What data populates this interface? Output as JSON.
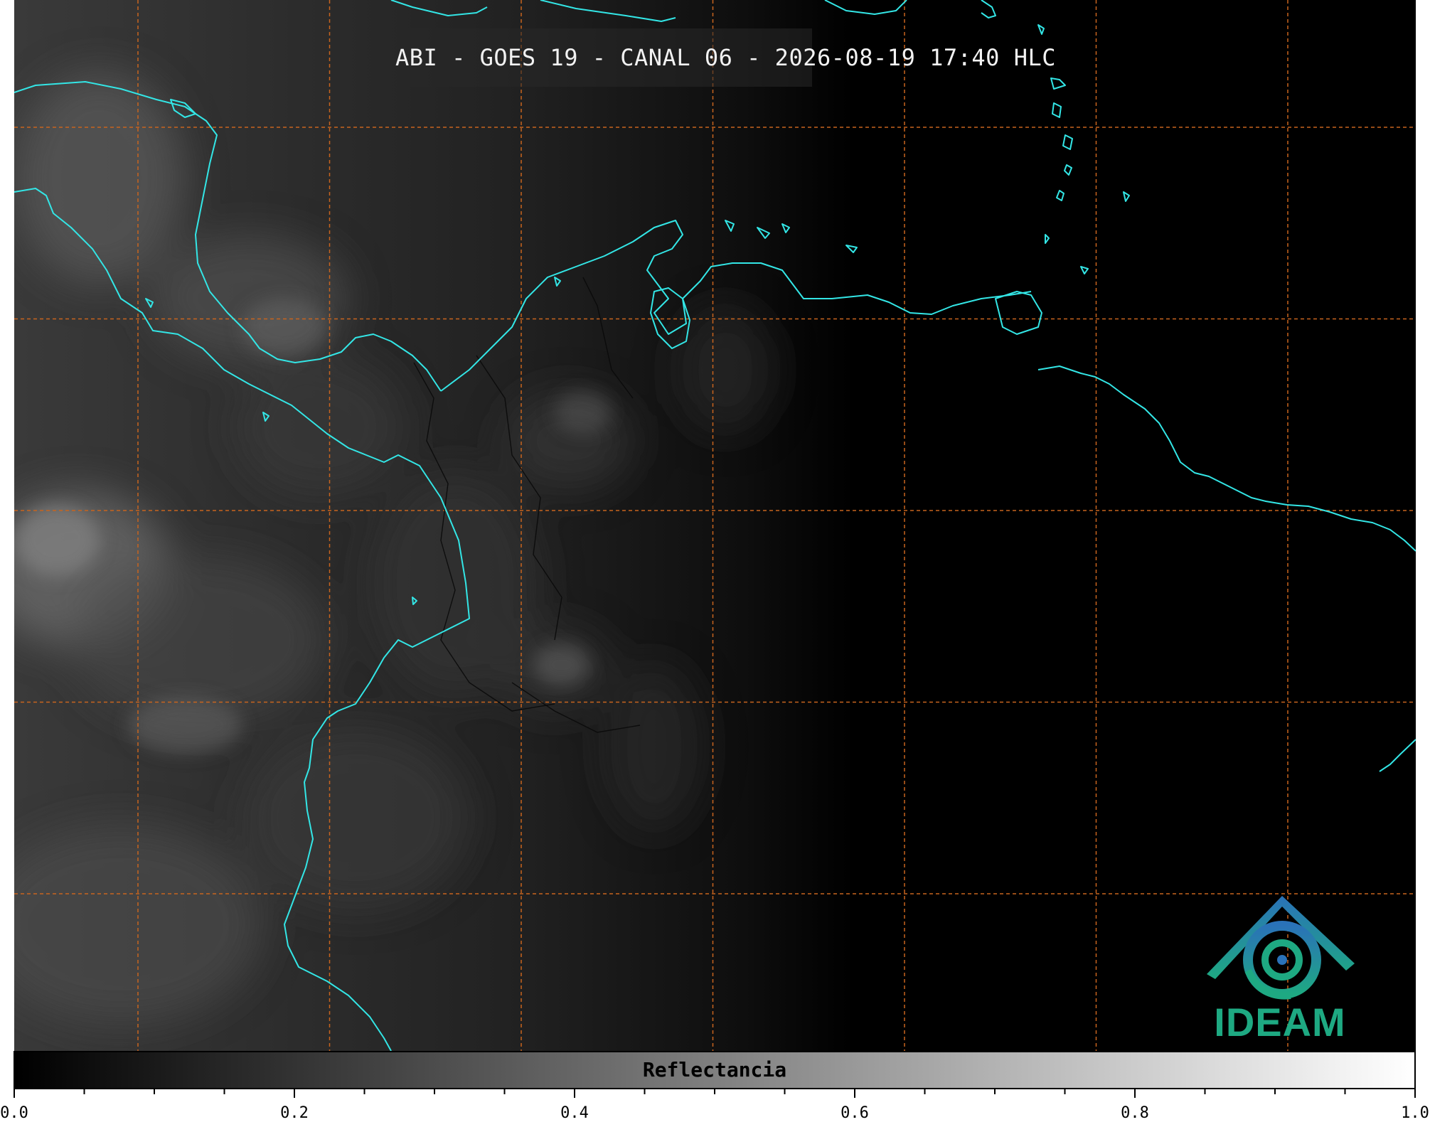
{
  "title": "ABI - GOES 19 - CANAL 06 - 2026-08-19 17:40 HLC",
  "colors": {
    "coastline": "#33e6e6",
    "gridline": "#c8641e",
    "background": "#000000",
    "logo_blue": "#2a72b8",
    "logo_green": "#1ea982"
  },
  "logo": {
    "text": "IDEAM",
    "icon": "ideam-mountain-swirl-logo"
  },
  "colorbar": {
    "label": "Reflectancia",
    "min": 0.0,
    "max": 1.0,
    "major_ticks": [
      "0.0",
      "0.2",
      "0.4",
      "0.6",
      "0.8",
      "1.0"
    ],
    "colormap": "grayscale black-to-white"
  },
  "grid": {
    "style": "dashed",
    "vertical_lines": 7,
    "horizontal_lines": 5
  }
}
